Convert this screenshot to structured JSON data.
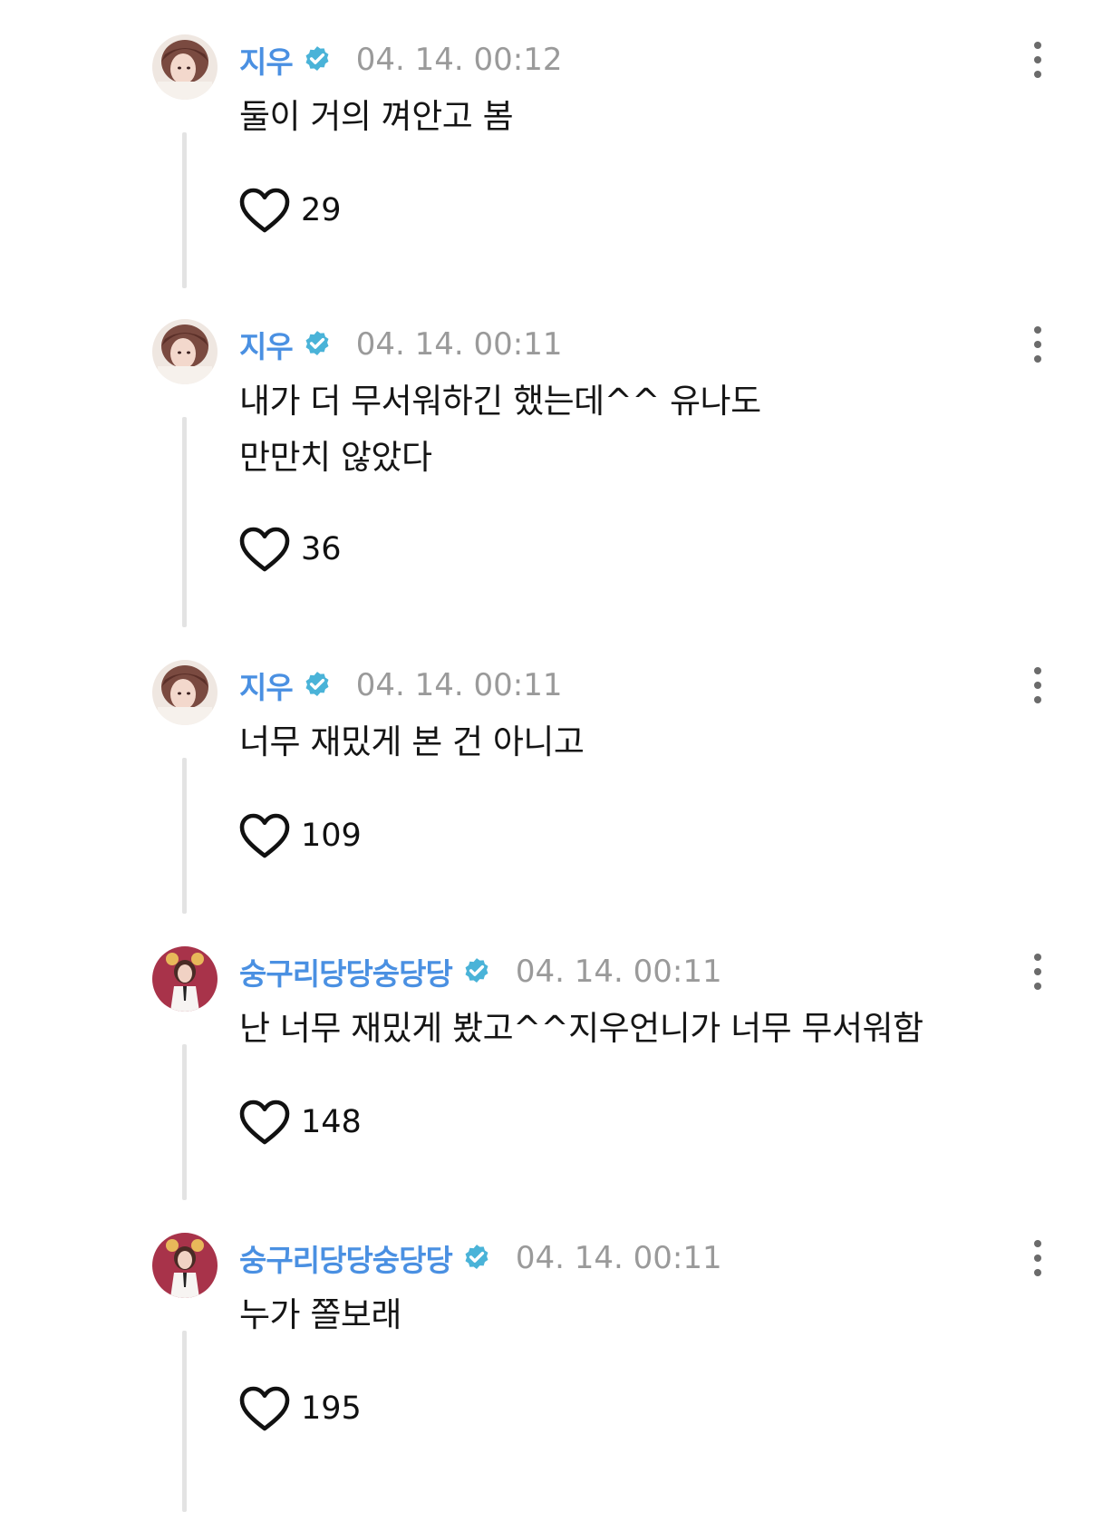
{
  "comments": [
    {
      "username": "지우",
      "timestamp": "04. 14. 00:12",
      "text": "둘이 거의 껴안고 봄",
      "likes": "29",
      "avatar": "avatar-jiwoo"
    },
    {
      "username": "지우",
      "timestamp": "04. 14. 00:11",
      "text": "내가 더 무서워하긴 했는데^^ 유나도\n만만치 않았다",
      "likes": "36",
      "avatar": "avatar-jiwoo"
    },
    {
      "username": "지우",
      "timestamp": "04. 14. 00:11",
      "text": "너무 재밌게 본 건 아니고",
      "likes": "109",
      "avatar": "avatar-jiwoo"
    },
    {
      "username": "숭구리당당숭당당",
      "timestamp": "04. 14. 00:11",
      "text": "난 너무 재밌게 봤고^^지우언니가 너무 무서워함",
      "likes": "148",
      "avatar": "avatar-yuna"
    },
    {
      "username": "숭구리당당숭당당",
      "timestamp": "04. 14. 00:11",
      "text": "누가 쫄보래",
      "likes": "195",
      "avatar": "avatar-yuna"
    }
  ],
  "colors": {
    "username": "#4a90e2",
    "verified": "#4ab3d8",
    "timestamp": "#9a9a9a",
    "thread_line": "#e3e3e3"
  },
  "icons": {
    "verified": "verified-badge-icon",
    "like": "heart-outline-icon",
    "more": "more-vertical-icon"
  }
}
